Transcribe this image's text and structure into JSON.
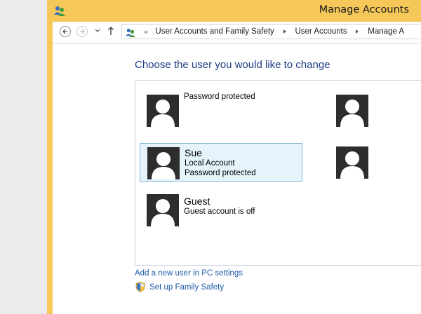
{
  "window": {
    "title": "Manage Accounts",
    "app_icon": "user-accounts-icon",
    "frame_color": "#f6c85a"
  },
  "addressbar": {
    "back_icon": "back-arrow-icon",
    "forward_icon": "forward-arrow-icon",
    "dropdown_icon": "chevron-down-icon",
    "up_icon": "up-arrow-icon",
    "overflow": "«",
    "breadcrumbs": [
      "User Accounts and Family Safety",
      "User Accounts",
      "Manage A"
    ]
  },
  "main": {
    "title": "Choose the user you would like to change",
    "accounts": [
      {
        "name": "",
        "line1": "",
        "line2": "",
        "status": "Password protected",
        "selected": false
      },
      {
        "name": "Sue",
        "line1": "Local Account",
        "status": "Password protected",
        "selected": true
      },
      {
        "name": "Guest",
        "status": "Guest account is off",
        "selected": false
      },
      {
        "name": "",
        "status": "",
        "selected": false
      },
      {
        "name": "",
        "status": "",
        "selected": false
      }
    ],
    "links": {
      "add_user": "Add a new user in PC settings",
      "family_safety": "Set up Family Safety"
    }
  },
  "colors": {
    "title_blue": "#1e3e84",
    "link_blue": "#1c5aa8",
    "selection_fill": "#e5f3fb",
    "selection_border": "#7eb4d6",
    "avatar": "#2d2d2d"
  }
}
